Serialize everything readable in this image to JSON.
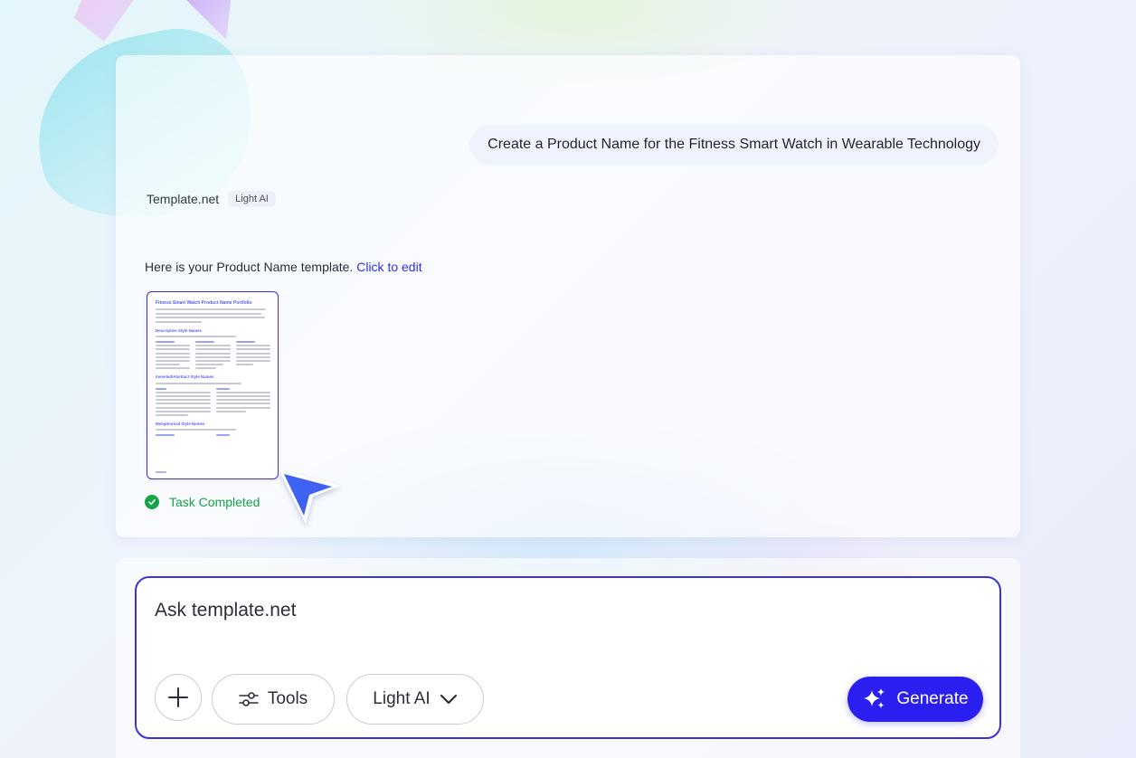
{
  "conversation": {
    "user_message": "Create a Product Name for the Fitness Smart Watch in Wearable Technology",
    "assistant": {
      "name": "Template.net",
      "model_badge": "Light AI",
      "response_text": "Here is your Product Name template.",
      "edit_link": "Click to edit",
      "document": {
        "title": "Fitness Smart Watch Product Name Portfolio",
        "sections": [
          "Descriptive Style Names",
          "Invented/Abstract Style Names",
          "Metaphorical Style Names"
        ]
      },
      "status": "Task Completed"
    }
  },
  "composer": {
    "placeholder": "Ask template.net",
    "tools_label": "Tools",
    "model_label": "Light AI",
    "generate_label": "Generate"
  },
  "colors": {
    "accent": "#2a1ef0",
    "border_accent": "#3b33d6",
    "success": "#16a34a",
    "link": "#2b2fe6"
  },
  "icons": {
    "add": "plus-icon",
    "tools": "sliders-icon",
    "dropdown": "chevron-down-icon",
    "generate": "sparkles-icon",
    "status": "check-circle-icon",
    "pointer": "cursor-arrow-icon"
  }
}
